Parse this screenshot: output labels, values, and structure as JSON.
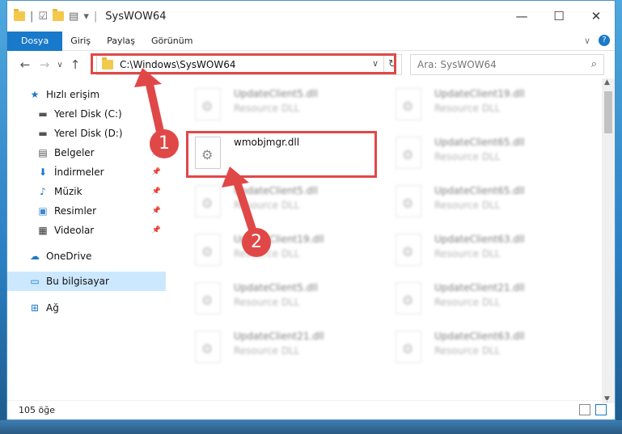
{
  "window": {
    "title": "SysWOW64"
  },
  "ribbon": {
    "tabs": [
      "Dosya",
      "Giriş",
      "Paylaş",
      "Görünüm"
    ]
  },
  "address": {
    "path": "C:\\Windows\\SysWOW64",
    "search_placeholder": "Ara: SysWOW64"
  },
  "sidebar": {
    "quick_access": "Hızlı erişim",
    "items": [
      {
        "label": "Yerel Disk (C:)",
        "icon": "drive-icon",
        "pinned": false
      },
      {
        "label": "Yerel Disk (D:)",
        "icon": "drive-icon",
        "pinned": false
      },
      {
        "label": "Belgeler",
        "icon": "documents-icon",
        "pinned": true
      },
      {
        "label": "İndirmeler",
        "icon": "downloads-icon",
        "pinned": true
      },
      {
        "label": "Müzik",
        "icon": "music-icon",
        "pinned": true
      },
      {
        "label": "Resimler",
        "icon": "pictures-icon",
        "pinned": true
      },
      {
        "label": "Videolar",
        "icon": "videos-icon",
        "pinned": true
      }
    ],
    "onedrive": "OneDrive",
    "this_pc": "Bu bilgisayar",
    "network": "Ağ"
  },
  "files": {
    "col1": [
      {
        "name": "UpdateClient5.dll",
        "type": "Resource DLL"
      },
      {
        "name": "wmobjmgr.dll",
        "type": ""
      },
      {
        "name": "UpdateClient5.dll",
        "type": "Resource DLL"
      },
      {
        "name": "UpdateClient19.dll",
        "type": "Resource DLL"
      },
      {
        "name": "UpdateClient5.dll",
        "type": "Resource DLL"
      },
      {
        "name": "UpdateClient21.dll",
        "type": "Resource DLL"
      }
    ],
    "col2": [
      {
        "name": "UpdateClient19.dll",
        "type": "Resource DLL"
      },
      {
        "name": "UpdateClient65.dll",
        "type": "Resource DLL"
      },
      {
        "name": "UpdateClient65.dll",
        "type": "Resource DLL"
      },
      {
        "name": "UpdateClient63.dll",
        "type": "Resource DLL"
      },
      {
        "name": "UpdateClient21.dll",
        "type": "Resource DLL"
      },
      {
        "name": "UpdateClient63.dll",
        "type": "Resource DLL"
      }
    ]
  },
  "status": {
    "count": "105 öğe"
  },
  "annotations": {
    "step1": "1",
    "step2": "2"
  },
  "colors": {
    "accent": "#1979ca",
    "highlight": "#e04848",
    "selected": "#cce8ff"
  }
}
